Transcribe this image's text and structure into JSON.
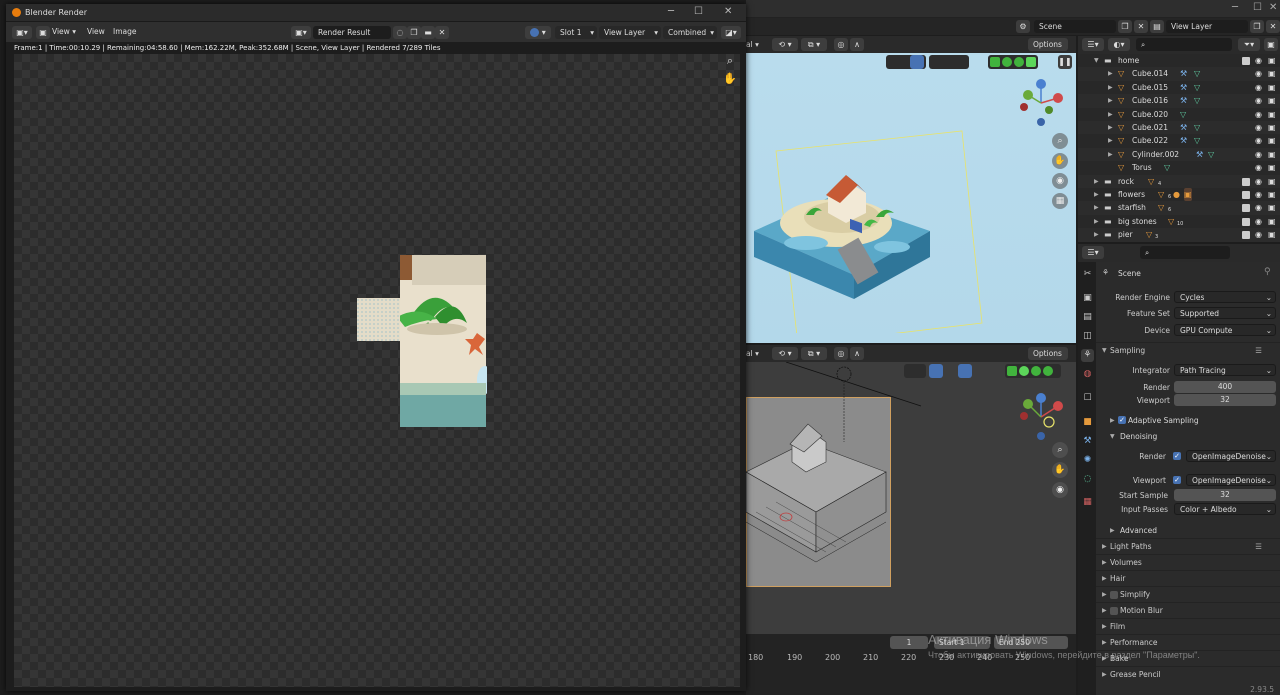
{
  "render_window": {
    "title": "Blender Render",
    "menus": [
      "View",
      "View",
      "Image"
    ],
    "image_name": "Render Result",
    "slot": "Slot 1",
    "view_layer": "View Layer",
    "pass": "Combined",
    "status": "Frame:1 | Time:00:10.29 | Remaining:04:58.60 | Mem:162.22M, Peak:352.68M | Scene, View Layer | Rendered 7/289 Tiles"
  },
  "topbar": {
    "scene_name": "Scene",
    "view_layer_name": "View Layer"
  },
  "viewport": {
    "options_label": "Options"
  },
  "outliner": {
    "items": [
      {
        "label": "home",
        "level": 0,
        "expanded": true
      },
      {
        "label": "Cube.014",
        "level": 1
      },
      {
        "label": "Cube.015",
        "level": 1
      },
      {
        "label": "Cube.016",
        "level": 1
      },
      {
        "label": "Cube.020",
        "level": 1
      },
      {
        "label": "Cube.021",
        "level": 1
      },
      {
        "label": "Cube.022",
        "level": 1
      },
      {
        "label": "Cylinder.002",
        "level": 1
      },
      {
        "label": "Torus",
        "level": 1
      },
      {
        "label": "rock",
        "level": 0,
        "badge": "4"
      },
      {
        "label": "flowers",
        "level": 0,
        "badge": "6"
      },
      {
        "label": "starfish",
        "level": 0,
        "badge": "6"
      },
      {
        "label": "big stones",
        "level": 0,
        "badge": "10"
      },
      {
        "label": "pier",
        "level": 0,
        "badge": "3"
      }
    ]
  },
  "properties": {
    "context_title": "Scene",
    "render_engine_label": "Render Engine",
    "render_engine": "Cycles",
    "feature_set_label": "Feature Set",
    "feature_set": "Supported",
    "device_label": "Device",
    "device": "GPU Compute",
    "sampling_title": "Sampling",
    "integrator_label": "Integrator",
    "integrator": "Path Tracing",
    "render_label": "Render",
    "render_samples": "400",
    "viewport_label": "Viewport",
    "viewport_samples": "32",
    "adaptive_sampling": "Adaptive Sampling",
    "denoising_title": "Denoising",
    "denoise_render_label": "Render",
    "denoise_render": "OpenImageDenoise",
    "denoise_viewport_label": "Viewport",
    "denoise_viewport": "OpenImageDenoise",
    "start_sample_label": "Start Sample",
    "start_sample": "32",
    "input_passes_label": "Input Passes",
    "input_passes": "Color + Albedo",
    "advanced": "Advanced",
    "sections": [
      "Light Paths",
      "Volumes",
      "Hair",
      "Simplify",
      "Motion Blur",
      "Film",
      "Performance",
      "Bake",
      "Grease Pencil"
    ]
  },
  "timeline": {
    "current_frame": "1",
    "start_label": "Start",
    "start": "1",
    "end_label": "End",
    "end": "250",
    "ticks": [
      "180",
      "190",
      "200",
      "210",
      "220",
      "230",
      "240",
      "250"
    ]
  },
  "watermark": {
    "line1": "Активация Windows",
    "line2": "Чтобы активировать Windows, перейдите в раздел \"Параметры\"."
  },
  "version": "2.93.5",
  "colors": {
    "accent": "#4772b3",
    "object_orange": "#e59a3c",
    "viewport_sky": "#b9dced"
  }
}
